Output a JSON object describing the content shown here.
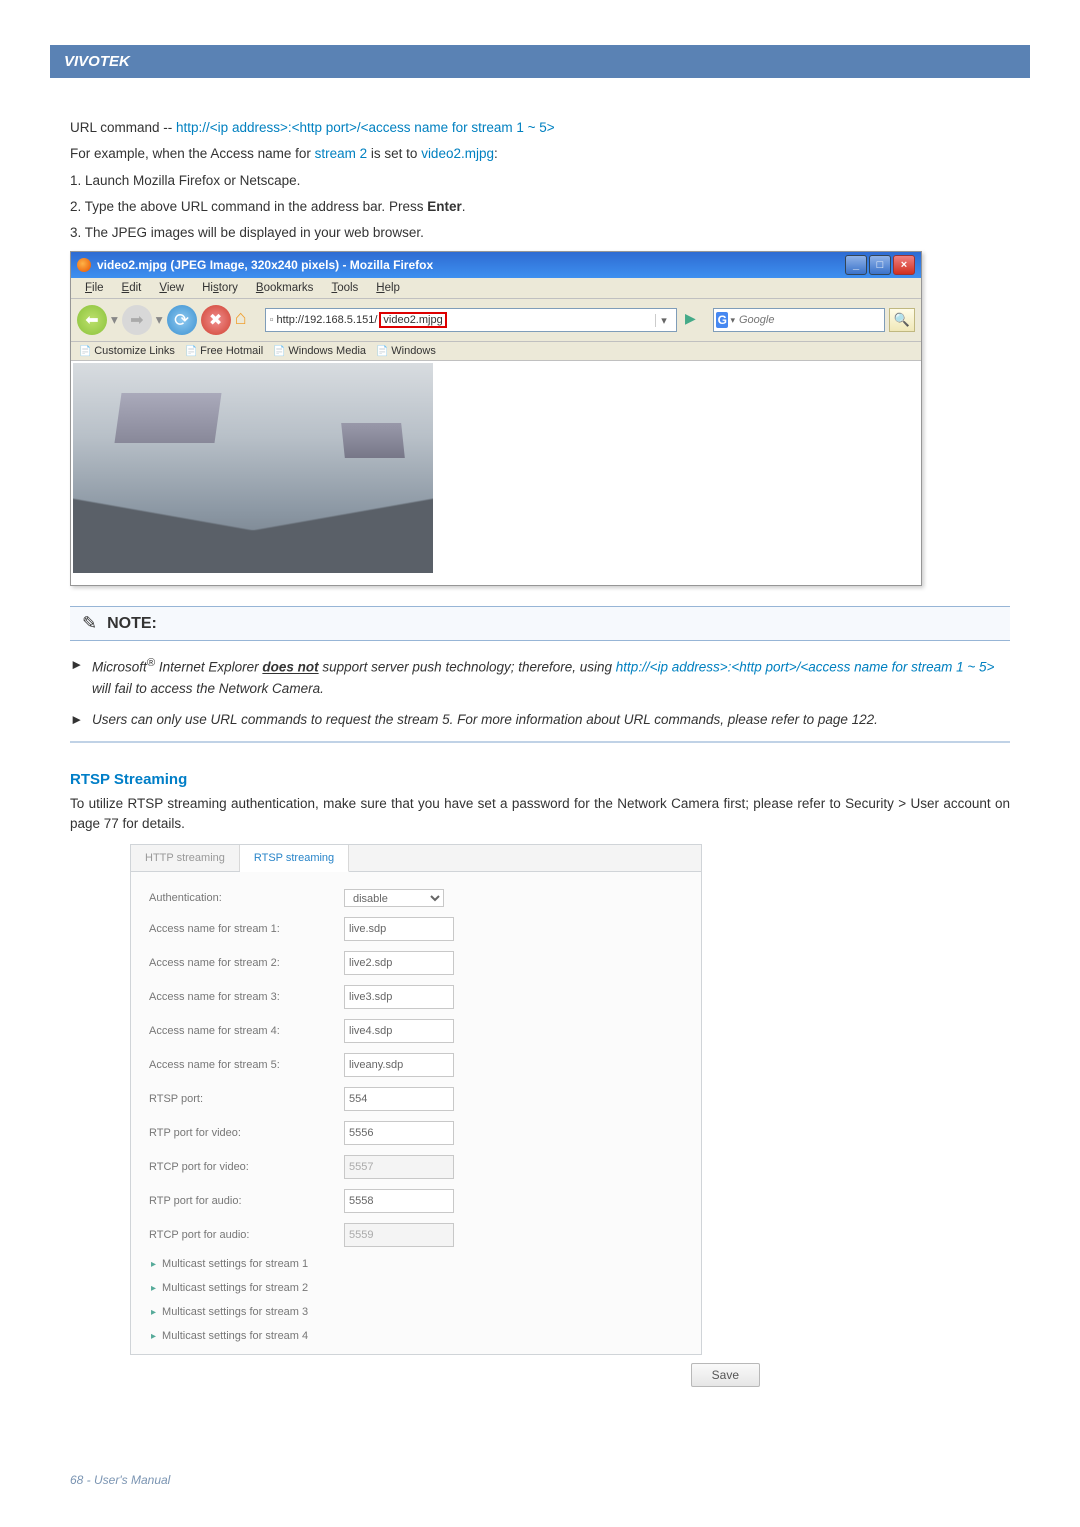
{
  "header": {
    "brand": "VIVOTEK"
  },
  "intro": {
    "cmd_label": "URL command -- ",
    "cmd": "http://<ip address>:<http port>/<access name for stream 1 ~ 5>",
    "ex_pre": "For example, when the Access name for ",
    "ex_stream": "stream 2",
    "ex_mid": " is set to ",
    "ex_file": "video2.mjpg",
    "ex_suf": ":",
    "step1": "1. Launch Mozilla Firefox or Netscape.",
    "step2_a": "2. Type the above URL command in the address bar. Press ",
    "step2_b": "Enter",
    "step2_c": ".",
    "step3": "3. The JPEG images will be displayed in your web browser."
  },
  "firefox": {
    "title": "video2.mjpg (JPEG Image, 320x240 pixels) - Mozilla Firefox",
    "menu": {
      "file": "File",
      "edit": "Edit",
      "view": "View",
      "history": "History",
      "bookmarks": "Bookmarks",
      "tools": "Tools",
      "help": "Help"
    },
    "addr_base": "http://192.168.5.151/",
    "addr_hl": "video2.mjpg",
    "search_placeholder": "Google",
    "bookmarks": [
      "Customize Links",
      "Free Hotmail",
      "Windows Media",
      "Windows"
    ]
  },
  "note": {
    "label": "NOTE:"
  },
  "notes": {
    "n1a": "Microsoft",
    "n1sup": "®",
    "n1b": " Internet Explorer ",
    "n1c": "does not",
    "n1d": " support server push technology; therefore, using ",
    "n1link": "http://<ip address>:<http port>/<access name for stream 1 ~ 5>",
    "n1e": " will fail to access the Network Camera.",
    "n2": "Users can only use URL commands to request the stream 5. For more information about URL commands, please refer to page 122."
  },
  "rtsp": {
    "title": "RTSP Streaming",
    "desc": "To utilize RTSP streaming authentication, make sure that you have set a password for the Network Camera first; please refer to Security > User account on page 77 for details.",
    "tabs": {
      "http": "HTTP streaming",
      "rtsp": "RTSP streaming"
    },
    "rows": {
      "auth_l": "Authentication:",
      "auth_v": "disable",
      "a1_l": "Access name for stream 1:",
      "a1_v": "live.sdp",
      "a2_l": "Access name for stream 2:",
      "a2_v": "live2.sdp",
      "a3_l": "Access name for stream 3:",
      "a3_v": "live3.sdp",
      "a4_l": "Access name for stream 4:",
      "a4_v": "live4.sdp",
      "a5_l": "Access name for stream 5:",
      "a5_v": "liveany.sdp",
      "rp_l": "RTSP port:",
      "rp_v": "554",
      "rtpv_l": "RTP port for video:",
      "rtpv_v": "5556",
      "rtcpv_l": "RTCP port for video:",
      "rtcpv_v": "5557",
      "rtpa_l": "RTP port for audio:",
      "rtpa_v": "5558",
      "rtcpa_l": "RTCP port for audio:",
      "rtcpa_v": "5559"
    },
    "mc": [
      "Multicast settings for stream 1",
      "Multicast settings for stream 2",
      "Multicast settings for stream 3",
      "Multicast settings for stream 4"
    ],
    "save": "Save"
  },
  "footer": "68 - User's Manual"
}
